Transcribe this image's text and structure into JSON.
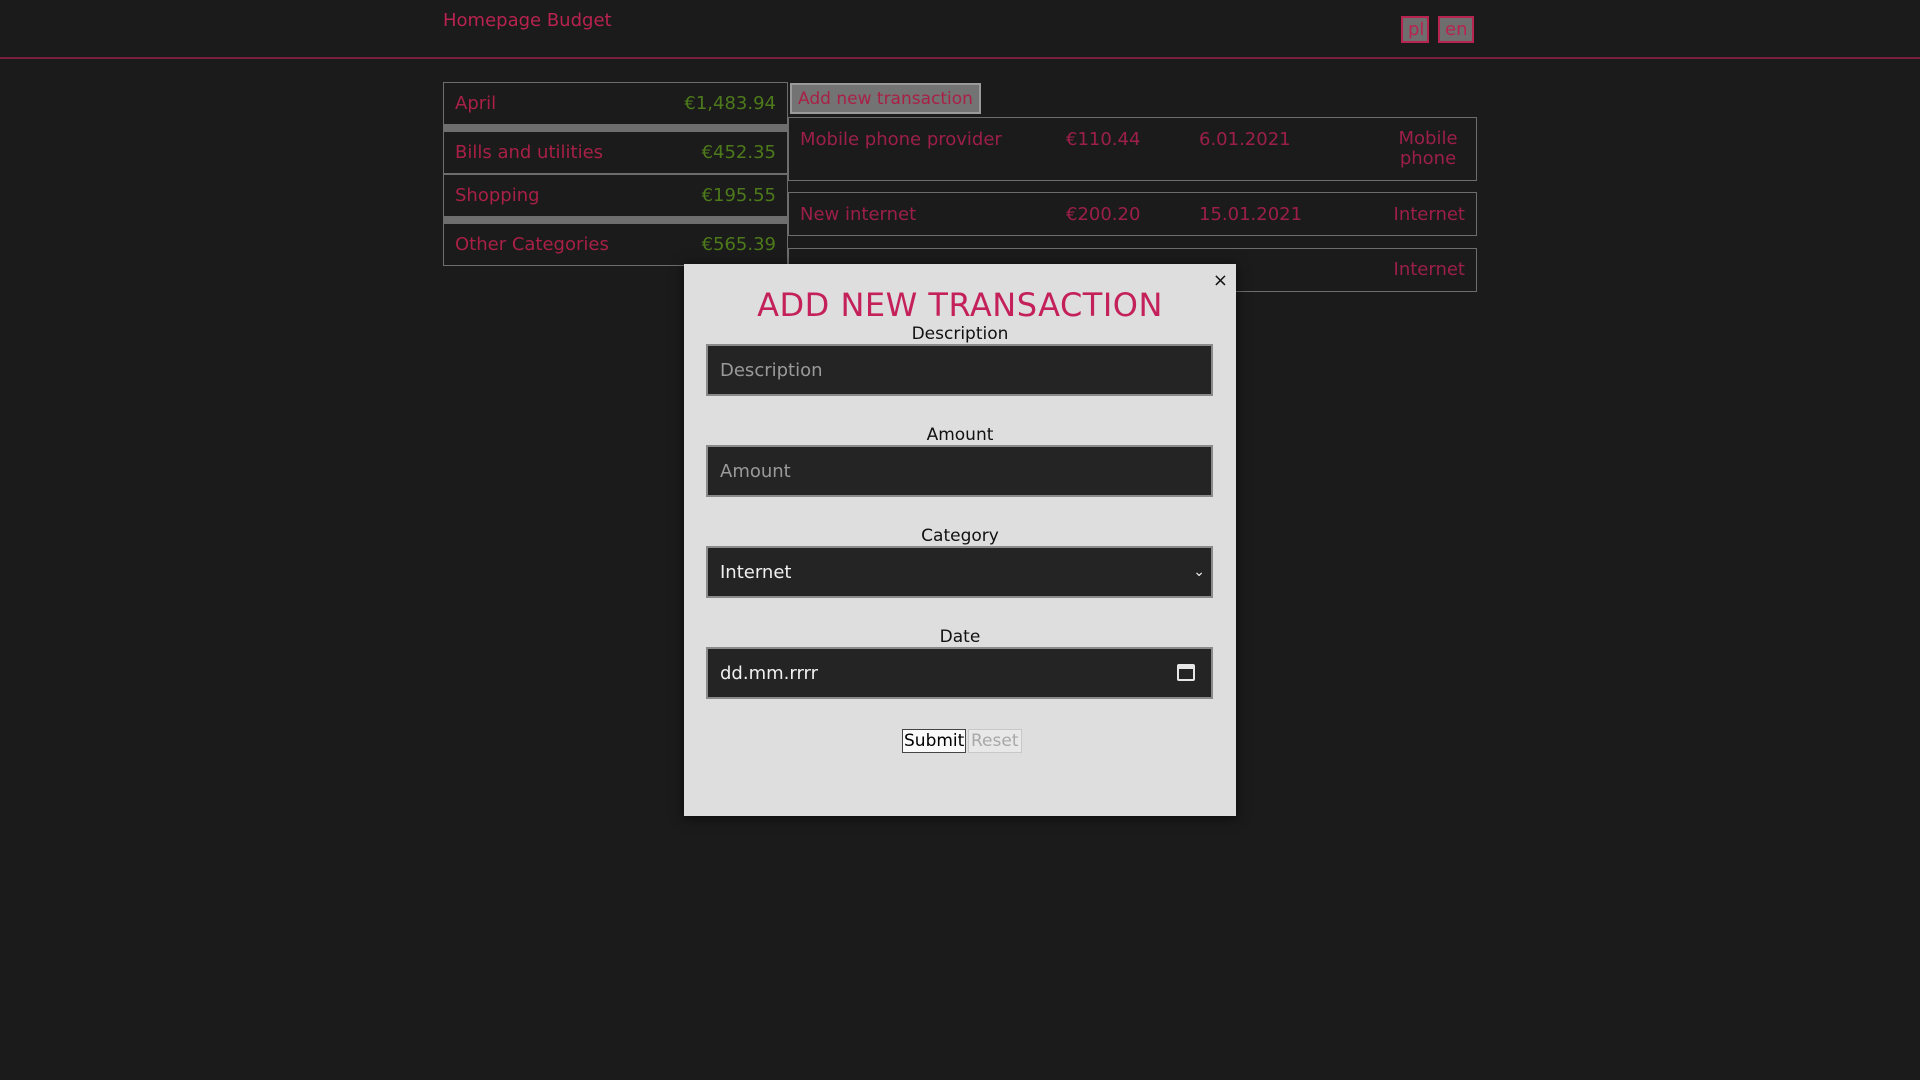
{
  "header": {
    "brand": "Homepage Budget",
    "languages": [
      "pl",
      "en"
    ]
  },
  "categories": [
    {
      "name": "April",
      "amount": "€1,483.94"
    },
    {
      "name": "Bills and utilities",
      "amount": "€452.35"
    },
    {
      "name": "Shopping",
      "amount": "€195.55"
    },
    {
      "name": "Other Categories",
      "amount": "€565.39"
    }
  ],
  "main": {
    "add_button_label": "Add new transaction",
    "transactions": [
      {
        "description": "Mobile phone provider",
        "amount": "€110.44",
        "date": "6.01.2021",
        "category": "Mobile phone"
      },
      {
        "description": "New internet",
        "amount": "€200.20",
        "date": "15.01.2021",
        "category": "Internet"
      },
      {
        "description": "",
        "amount": "",
        "date": "",
        "category": "Internet"
      }
    ]
  },
  "modal": {
    "close_icon": "×",
    "title": "ADD NEW TRANSACTION",
    "description_label": "Description",
    "description_placeholder": "Description",
    "amount_label": "Amount",
    "amount_placeholder": "Amount",
    "category_label": "Category",
    "category_value": "Internet",
    "date_label": "Date",
    "date_placeholder": "dd.mm.rrrr",
    "submit_label": "Submit",
    "reset_label": "Reset"
  },
  "colors": {
    "accent": "#c4205a",
    "background": "#1b1b1b",
    "positive_amount": "#4d7a1a"
  }
}
